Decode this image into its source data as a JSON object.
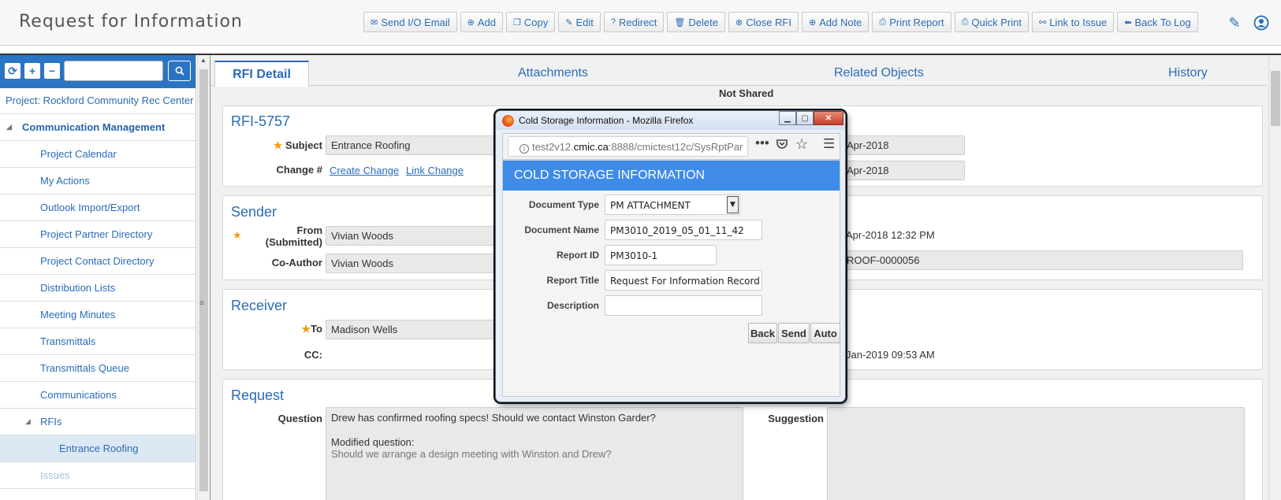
{
  "header": {
    "title": "Request for Information",
    "toolbar": [
      {
        "icon": "envelope-icon",
        "glyph": "✉",
        "label": "Send I/O Email"
      },
      {
        "icon": "plus-circle-icon",
        "glyph": "⊕",
        "label": "Add"
      },
      {
        "icon": "copy-icon",
        "glyph": "❐",
        "label": "Copy"
      },
      {
        "icon": "pencil-icon",
        "glyph": "✎",
        "label": "Edit"
      },
      {
        "icon": "question-circle-icon",
        "glyph": "?",
        "label": "Redirect"
      },
      {
        "icon": "trash-icon",
        "glyph": "🗑",
        "label": "Delete"
      },
      {
        "icon": "close-circle-icon",
        "glyph": "⊗",
        "label": "Close RFI"
      },
      {
        "icon": "plus-circle-icon",
        "glyph": "⊕",
        "label": "Add Note"
      },
      {
        "icon": "printer-icon",
        "glyph": "⎙",
        "label": "Print Report"
      },
      {
        "icon": "printer-icon",
        "glyph": "⎙",
        "label": "Quick Print"
      },
      {
        "icon": "link-icon",
        "glyph": "⚯",
        "label": "Link to Issue"
      },
      {
        "icon": "arrow-left-icon",
        "glyph": "⬅",
        "label": "Back To Log"
      }
    ],
    "right_icons": [
      "edit-icon",
      "user-icon"
    ]
  },
  "sidebar": {
    "project": "Project: Rockford Community Rec Center",
    "items": [
      {
        "label": "Communication Management",
        "level": 0
      },
      {
        "label": "Project Calendar",
        "level": 1
      },
      {
        "label": "My Actions",
        "level": 1
      },
      {
        "label": "Outlook Import/Export",
        "level": 1
      },
      {
        "label": "Project Partner Directory",
        "level": 1
      },
      {
        "label": "Project Contact Directory",
        "level": 1
      },
      {
        "label": "Distribution Lists",
        "level": 1
      },
      {
        "label": "Meeting Minutes",
        "level": 1
      },
      {
        "label": "Transmittals",
        "level": 1
      },
      {
        "label": "Transmittals Queue",
        "level": 1
      },
      {
        "label": "Communications",
        "level": 1
      },
      {
        "label": "RFIs",
        "level": 1
      },
      {
        "label": "Entrance Roofing",
        "level": 2
      },
      {
        "label": "Issues",
        "level": 1
      }
    ]
  },
  "tabs": [
    "RFI Detail",
    "Attachments",
    "Related Objects",
    "History"
  ],
  "status": "Not Shared",
  "rfi": {
    "id": "RFI-5757",
    "subject_label": "Subject",
    "subject": "Entrance Roofing",
    "change_label": "Change #",
    "create_change": "Create Change",
    "link_change": "Link Change",
    "date1": "Apr-2018",
    "date2": "Apr-2018"
  },
  "sender": {
    "title": "Sender",
    "from_label": "From\n(Submitted)",
    "from": "Vivian Woods",
    "coauthor_label": "Co-Author",
    "coauthor": "Vivian Woods",
    "submitted_date": "Apr-2018 12:32 PM",
    "ref": "ROOF-0000056"
  },
  "receiver": {
    "title": "Receiver",
    "to_label": "To",
    "to": "Madison Wells",
    "cc_label": "CC:",
    "date": "Jan-2019 09:53 AM"
  },
  "request": {
    "title": "Request",
    "question_label": "Question",
    "question_line1": "Drew has confirmed roofing specs! Should we contact Winston Garder?",
    "question_line2": "Modified question:",
    "question_line3": "Should we arrange a design meeting with Winston and Drew?",
    "suggestion_label": "Suggestion"
  },
  "popup": {
    "window_title": "Cold Storage Information - Mozilla Firefox",
    "url_prefix": "test2v12.",
    "url_domain": "cmic.ca",
    "url_rest": ":8888/cmictest12c/SysRptPar",
    "heading": "COLD STORAGE INFORMATION",
    "fields": {
      "doc_type_label": "Document Type",
      "doc_type": "PM ATTACHMENT",
      "doc_name_label": "Document Name",
      "doc_name": "PM3010_2019_05_01_11_42",
      "report_id_label": "Report ID",
      "report_id": "PM3010-1",
      "report_title_label": "Report Title",
      "report_title": "Request For Information Record",
      "description_label": "Description",
      "description": ""
    },
    "buttons": {
      "back": "Back",
      "send": "Send",
      "auto": "Auto"
    }
  }
}
